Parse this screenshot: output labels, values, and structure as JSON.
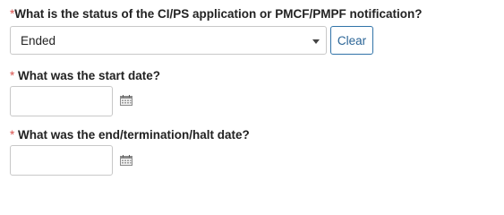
{
  "status_question": {
    "required_marker": "*",
    "label": "What is the status of the CI/PS application or PMCF/PMPF notification?",
    "selected_value": "Ended",
    "clear_label": "Clear"
  },
  "start_date": {
    "required_marker": "*",
    "label": " What was the start date?",
    "value": ""
  },
  "end_date": {
    "required_marker": "*",
    "label": " What was the end/termination/halt date?",
    "value": ""
  },
  "icons": {
    "dropdown": "chevron-down-icon",
    "calendar": "calendar-icon"
  },
  "colors": {
    "required": "#d9534f",
    "clear_border": "#3173a8",
    "clear_text": "#2a6496",
    "input_border": "#c8c8c8"
  }
}
